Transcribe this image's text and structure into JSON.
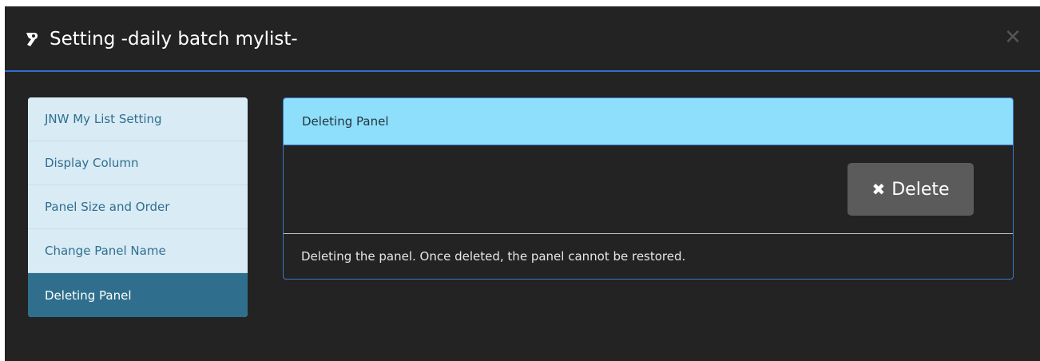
{
  "modal": {
    "title": "Setting -daily batch mylist-",
    "close_glyph": "✕",
    "title_icon": "wrench-icon",
    "accent_color": "#2f6fd1"
  },
  "sidebar": {
    "items": [
      {
        "label": "JNW My List Setting",
        "active": false
      },
      {
        "label": "Display Column",
        "active": false
      },
      {
        "label": "Panel Size and Order",
        "active": false
      },
      {
        "label": "Change Panel Name",
        "active": false
      },
      {
        "label": "Deleting Panel",
        "active": true
      }
    ]
  },
  "panel": {
    "heading": "Deleting Panel",
    "delete_button": {
      "icon": "x-icon",
      "icon_glyph": "✖",
      "label": "Delete"
    },
    "footer_text": "Deleting the panel. Once deleted, the panel cannot be restored."
  }
}
